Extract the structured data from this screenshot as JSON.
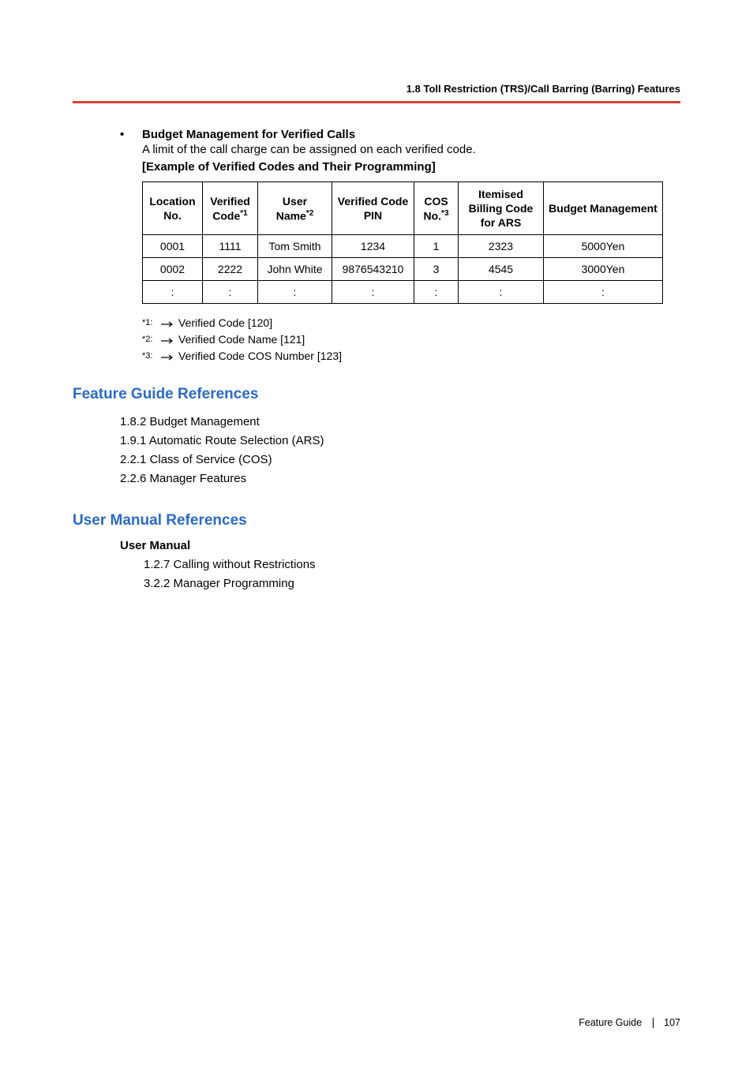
{
  "header": {
    "section_title": "1.8 Toll Restriction (TRS)/Call Barring (Barring) Features"
  },
  "bullet": {
    "title": "Budget Management for Verified Calls",
    "desc": "A limit of the call charge can be assigned on each verified code.",
    "example_title": "[Example of Verified Codes and Their Programming]"
  },
  "table": {
    "headers": {
      "location": "Location No.",
      "verified_code": "Verified Code",
      "verified_code_sup": "*1",
      "user_name": "User Name",
      "user_name_sup": "*2",
      "verified_pin": "Verified Code PIN",
      "cos_no": "COS No.",
      "cos_no_sup": "*3",
      "itemised": "Itemised Billing Code for ARS",
      "budget": "Budget Management"
    },
    "rows": [
      {
        "location": "0001",
        "code": "1111",
        "name": "Tom Smith",
        "pin": "1234",
        "cos": "1",
        "billing": "2323",
        "budget": "5000Yen"
      },
      {
        "location": "0002",
        "code": "2222",
        "name": "John White",
        "pin": "9876543210",
        "cos": "3",
        "billing": "4545",
        "budget": "3000Yen"
      },
      {
        "location": ":",
        "code": ":",
        "name": ":",
        "pin": ":",
        "cos": ":",
        "billing": ":",
        "budget": ":"
      }
    ]
  },
  "footnotes": {
    "f1_label": "*1:",
    "f1_text": "Verified Code [120]",
    "f2_label": "*2:",
    "f2_text": "Verified Code Name [121]",
    "f3_label": "*3:",
    "f3_text": "Verified Code COS Number [123]"
  },
  "fgr": {
    "title": "Feature Guide References",
    "items": [
      "1.8.2 Budget Management",
      "1.9.1 Automatic Route Selection (ARS)",
      "2.2.1 Class of Service (COS)",
      "2.2.6 Manager Features"
    ]
  },
  "umr": {
    "title": "User Manual References",
    "label": "User Manual",
    "items": [
      "1.2.7 Calling without Restrictions",
      "3.2.2 Manager Programming"
    ]
  },
  "footer": {
    "label": "Feature Guide",
    "page": "107"
  }
}
